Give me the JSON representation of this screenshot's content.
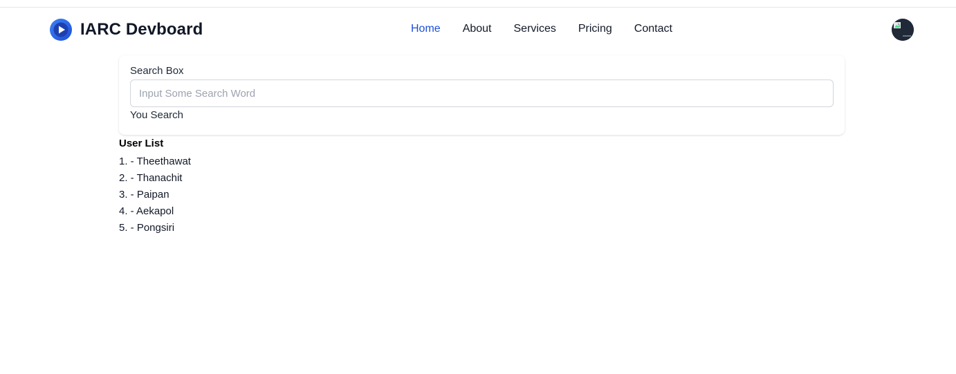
{
  "header": {
    "brand_name": "IARC Devboard",
    "logo_icon": "play-circle-icon",
    "nav": [
      {
        "label": "Home",
        "active": true
      },
      {
        "label": "About",
        "active": false
      },
      {
        "label": "Services",
        "active": false
      },
      {
        "label": "Pricing",
        "active": false
      },
      {
        "label": "Contact",
        "active": false
      }
    ],
    "avatar_icon": "user-avatar-icon"
  },
  "search": {
    "label": "Search Box",
    "placeholder": "Input Some Search Word",
    "value": "",
    "result_label": "You Search"
  },
  "users": {
    "title": "User List",
    "items": [
      "1. - Theethawat",
      "2. - Thanachit",
      "3. - Paipan",
      "4. - Aekapol",
      "5. - Pongsiri"
    ]
  },
  "colors": {
    "accent": "#1d4ed8",
    "text": "#111827",
    "logo_blue": "#1e6bf0",
    "avatar": "#1f2937"
  }
}
